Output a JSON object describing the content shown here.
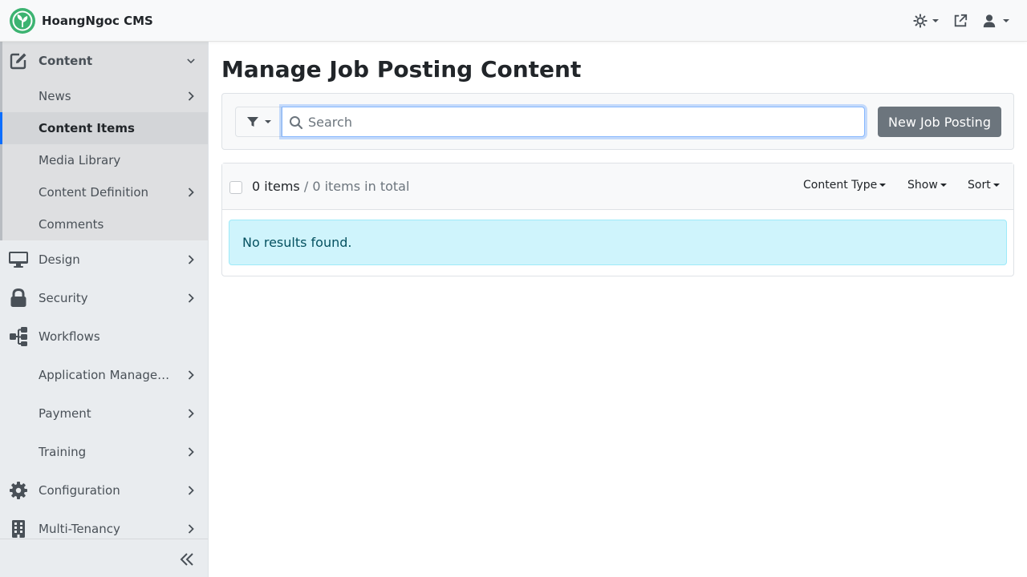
{
  "brand": {
    "name": "HoangNgoc CMS"
  },
  "sidebar": {
    "items": [
      {
        "label": "Content",
        "icon": "edit-icon",
        "expanded": true
      },
      {
        "label": "News",
        "sub": true
      },
      {
        "label": "Content Items",
        "sub": true,
        "active": true
      },
      {
        "label": "Media Library",
        "sub": true
      },
      {
        "label": "Content Definition",
        "sub": true
      },
      {
        "label": "Comments",
        "sub": true
      },
      {
        "label": "Design",
        "icon": "monitor-icon"
      },
      {
        "label": "Security",
        "icon": "lock-icon"
      },
      {
        "label": "Workflows",
        "icon": "workflow-icon"
      },
      {
        "label": "Application Managem..."
      },
      {
        "label": "Payment"
      },
      {
        "label": "Training"
      },
      {
        "label": "Configuration",
        "icon": "cog-icon"
      },
      {
        "label": "Multi-Tenancy",
        "icon": "building-icon"
      }
    ]
  },
  "main": {
    "title": "Manage Job Posting Content",
    "search_placeholder": "Search",
    "new_button": "New Job Posting",
    "count_visible": "0 items",
    "count_total": " / 0 items in total",
    "dropdowns": {
      "content_type": "Content Type",
      "show": "Show",
      "sort": "Sort"
    },
    "empty_message": "No results found."
  },
  "colors": {
    "accent": "#0d6efd",
    "button_secondary": "#6c757d",
    "alert_bg": "#cff4fc",
    "alert_text": "#055160",
    "logo_green": "#3cb371"
  }
}
